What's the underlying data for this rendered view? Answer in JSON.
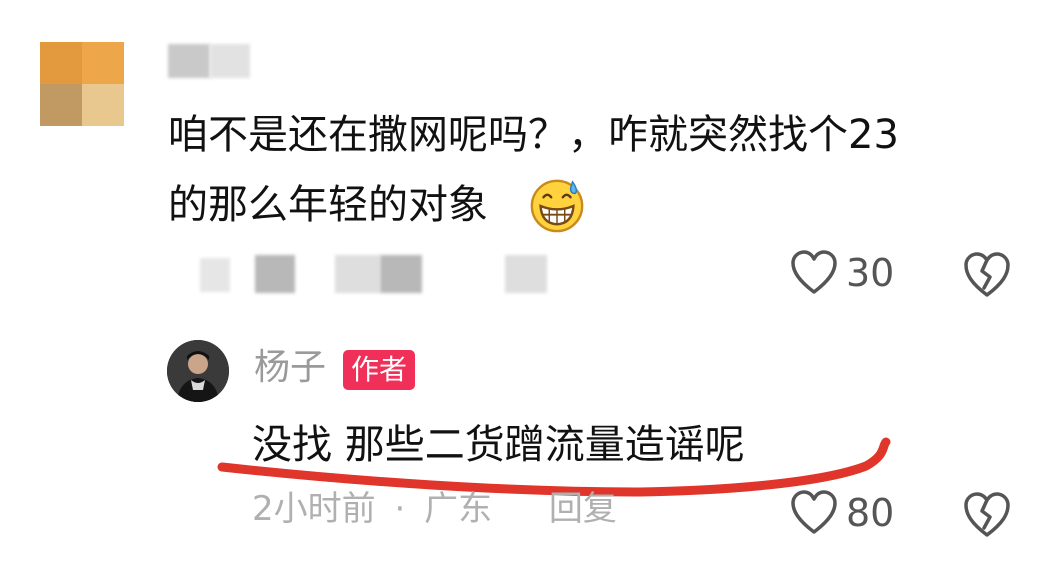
{
  "comment": {
    "line1": "咱不是还在撒网呢吗？，咋就突然找个23",
    "line2": "的那么年轻的对象",
    "emoji_icon": "grinning-sweat-emoji",
    "likes": "30"
  },
  "reply": {
    "username": "杨子",
    "author_badge": "作者",
    "text": "没找 那些二货蹭流量造谣呢",
    "time": "2小时前",
    "separator": "·",
    "location": "广东",
    "reply_label": "回复",
    "likes": "80"
  },
  "colors": {
    "badge": "#f03058",
    "underline": "#e0352b",
    "muted_text": "#9a9a9a"
  }
}
